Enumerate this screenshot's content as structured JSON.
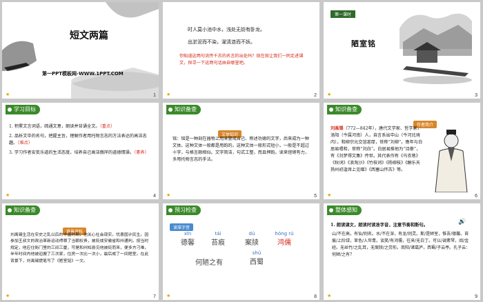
{
  "slides": [
    {
      "num": "1",
      "title": "短文两篇",
      "subtitle": "第一PPT模板网-WWW.1PPT.COM"
    },
    {
      "num": "2",
      "poem1": "时人莫小池中水，浅处无妨有卧龙。",
      "poem2": "出淤泥而不染，濯清涟而不妖。",
      "question": "你知道这两句流传千古的名言的出处吗？现在就让我们一同走进课文，探寻一下这两句话由自哪里吧。"
    },
    {
      "num": "3",
      "badge": "第一课时",
      "title": "陋室铭"
    },
    {
      "num": "4",
      "header": "学习目标",
      "items": [
        "1. 积累文言词语，疏通文意，朗读并背诵全文。",
        "2. 品析文中的名句，把握主旨，理解作者用托物言志的方法表达的高洁志趣。",
        "3. 学习作者安贫乐道的生活态度，培养自己高洁傲岸的道德情操。"
      ],
      "keys": [
        "（重点）",
        "（难点）",
        "（素养）"
      ]
    },
    {
      "num": "5",
      "header": "知识备查",
      "tag": "文体知识",
      "text": "铭：铭是一种刻在器物上用来警戒自己、称述功德的文字，后来成为一种文体。这种文体一般都是用韵的。这种文体一般形式短小，一般是不超过十字，与格言颇相似。文字简洁，句式工整，而且押韵。读来铿锵有力，多用托物言志的手法。"
    },
    {
      "num": "6",
      "header": "知识备查",
      "tag": "作者简介",
      "name": "刘禹锡",
      "text": "（772—842年），唐代文学家、哲学家，洛阳（今属河南）人，自言系出中山（今河北境内）。和柳宗元交谊甚厚，世称“刘柳”。晚年与白居易唱和，世称“刘白”。白居易推他为“诗豪”，有《刘梦得文集》传世。其代表作有《乌衣巷》《秋词》《浪淘沙》《竹枝词》《杨柳枝》《酬乐天扬州初逢席上见赠》《西塞山怀古》等。"
    },
    {
      "num": "7",
      "header": "知识备查",
      "tag": "背景资料",
      "text": "刘禹锡生活在安史之乱以后的中唐时期，他关心社会现实，忧患国计民生。因参加王叔文的政治革新运动得罪了当朝权贵，被贬成安徽省和州通判。按当时规定，他应住衙门里的三间三厦，可是和州知县见他被贬而来，便多方刁难，半年时间内他被迫搬了三次家，住房一次比一次小，最后成了一间陋室。在此背景下，刘禹锡提笔写了《陋室铭》一文。"
    },
    {
      "num": "8",
      "header": "预习检查",
      "tag": "读准字音",
      "chars": [
        [
          "xīn",
          "德馨"
        ],
        [
          "tái",
          "苔痕"
        ],
        [
          "dú",
          "案牍"
        ],
        [
          "hóng rú",
          "鸿儒"
        ],
        [
          "",
          "何陋之有"
        ],
        [
          "shǔ",
          "西蜀"
        ]
      ]
    },
    {
      "num": "9",
      "header": "整体感知",
      "prompt": "1. 朗读课文，朗读时读准字音，注意节奏和断句。",
      "text": "山/不在高，有仙/则名。水/不在深，有龙/则灵。斯/是陋室，惟吾/德馨。苔痕/上阶绿，草色/入帘青。谈笑/有鸿儒，往来/无白丁。可以/调素琴，阅/金经。无丝竹/之乱耳，无案牍/之劳形。南阳/诸葛庐，西蜀/子云亭。孔子云：何陋/之有？"
    }
  ],
  "colors": {
    "header": "#3a8a2a",
    "accent": "#d52a1a",
    "tag": "#d8862a"
  }
}
